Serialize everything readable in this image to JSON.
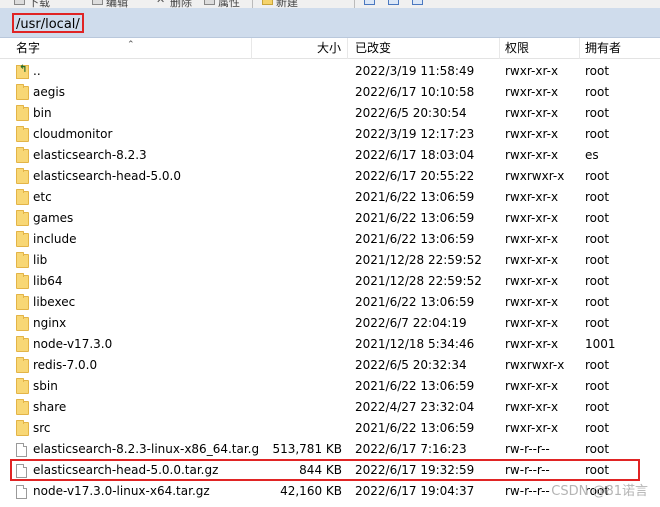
{
  "toolbar": {
    "items": [
      {
        "label": "下载",
        "icon": "download-icon"
      },
      {
        "label": "编辑",
        "icon": "edit-icon"
      },
      {
        "label": "删除",
        "icon": "delete-icon"
      },
      {
        "label": "属性",
        "icon": "properties-icon"
      },
      {
        "label": "新建",
        "icon": "new-folder-icon"
      }
    ]
  },
  "path": "/usr/local/",
  "columns": {
    "name": "名字",
    "size": "大小",
    "modified": "已改变",
    "permissions": "权限",
    "owner": "拥有者"
  },
  "files": [
    {
      "name": "..",
      "type": "parent",
      "size": "",
      "modified": "2022/3/19 11:58:49",
      "permissions": "rwxr-xr-x",
      "owner": "root"
    },
    {
      "name": "aegis",
      "type": "folder",
      "size": "",
      "modified": "2022/6/17 10:10:58",
      "permissions": "rwxr-xr-x",
      "owner": "root"
    },
    {
      "name": "bin",
      "type": "folder",
      "size": "",
      "modified": "2022/6/5 20:30:54",
      "permissions": "rwxr-xr-x",
      "owner": "root"
    },
    {
      "name": "cloudmonitor",
      "type": "folder",
      "size": "",
      "modified": "2022/3/19 12:17:23",
      "permissions": "rwxr-xr-x",
      "owner": "root"
    },
    {
      "name": "elasticsearch-8.2.3",
      "type": "folder",
      "size": "",
      "modified": "2022/6/17 18:03:04",
      "permissions": "rwxr-xr-x",
      "owner": "es"
    },
    {
      "name": "elasticsearch-head-5.0.0",
      "type": "folder",
      "size": "",
      "modified": "2022/6/17 20:55:22",
      "permissions": "rwxrwxr-x",
      "owner": "root"
    },
    {
      "name": "etc",
      "type": "folder",
      "size": "",
      "modified": "2021/6/22 13:06:59",
      "permissions": "rwxr-xr-x",
      "owner": "root"
    },
    {
      "name": "games",
      "type": "folder",
      "size": "",
      "modified": "2021/6/22 13:06:59",
      "permissions": "rwxr-xr-x",
      "owner": "root"
    },
    {
      "name": "include",
      "type": "folder",
      "size": "",
      "modified": "2021/6/22 13:06:59",
      "permissions": "rwxr-xr-x",
      "owner": "root"
    },
    {
      "name": "lib",
      "type": "folder",
      "size": "",
      "modified": "2021/12/28 22:59:52",
      "permissions": "rwxr-xr-x",
      "owner": "root"
    },
    {
      "name": "lib64",
      "type": "folder",
      "size": "",
      "modified": "2021/12/28 22:59:52",
      "permissions": "rwxr-xr-x",
      "owner": "root"
    },
    {
      "name": "libexec",
      "type": "folder",
      "size": "",
      "modified": "2021/6/22 13:06:59",
      "permissions": "rwxr-xr-x",
      "owner": "root"
    },
    {
      "name": "nginx",
      "type": "folder",
      "size": "",
      "modified": "2022/6/7 22:04:19",
      "permissions": "rwxr-xr-x",
      "owner": "root"
    },
    {
      "name": "node-v17.3.0",
      "type": "folder",
      "size": "",
      "modified": "2021/12/18 5:34:46",
      "permissions": "rwxr-xr-x",
      "owner": "1001"
    },
    {
      "name": "redis-7.0.0",
      "type": "folder",
      "size": "",
      "modified": "2022/6/5 20:32:34",
      "permissions": "rwxrwxr-x",
      "owner": "root"
    },
    {
      "name": "sbin",
      "type": "folder",
      "size": "",
      "modified": "2021/6/22 13:06:59",
      "permissions": "rwxr-xr-x",
      "owner": "root"
    },
    {
      "name": "share",
      "type": "folder",
      "size": "",
      "modified": "2022/4/27 23:32:04",
      "permissions": "rwxr-xr-x",
      "owner": "root"
    },
    {
      "name": "src",
      "type": "folder",
      "size": "",
      "modified": "2021/6/22 13:06:59",
      "permissions": "rwxr-xr-x",
      "owner": "root"
    },
    {
      "name": "elasticsearch-8.2.3-linux-x86_64.tar.gz",
      "type": "file",
      "size": "513,781 KB",
      "modified": "2022/6/17 7:16:23",
      "permissions": "rw-r--r--",
      "owner": "root"
    },
    {
      "name": "elasticsearch-head-5.0.0.tar.gz",
      "type": "file",
      "size": "844 KB",
      "modified": "2022/6/17 19:32:59",
      "permissions": "rw-r--r--",
      "owner": "root"
    },
    {
      "name": "node-v17.3.0-linux-x64.tar.gz",
      "type": "file",
      "size": "42,160 KB",
      "modified": "2022/6/17 19:04:37",
      "permissions": "rw-r--r--",
      "owner": "root"
    }
  ],
  "highlight_colors": {
    "box": "#e02424",
    "pathbar": "#cfdcec"
  },
  "watermark": "CSDN @81诺言"
}
